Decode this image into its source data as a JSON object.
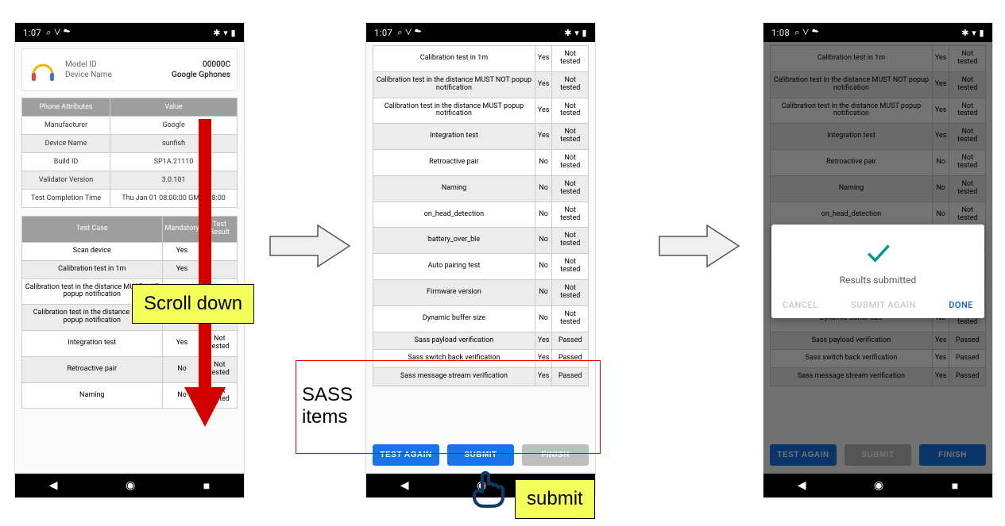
{
  "status": {
    "time1": "1:07",
    "time3": "1:08",
    "leftIcons": "⌕ ⋁ ☁",
    "rightIcons": "✱ ▾ ▮"
  },
  "header": {
    "modelIdLabel": "Model ID",
    "modelId": "00000C",
    "deviceNameLabel": "Device Name",
    "deviceName": "Google Gphones"
  },
  "attr": {
    "h1": "Phone Attributes",
    "h2": "Value",
    "rows": [
      {
        "k": "Manufacturer",
        "v": "Google"
      },
      {
        "k": "Device Name",
        "v": "sunfish"
      },
      {
        "k": "Build ID",
        "v": "SP1A.21110"
      },
      {
        "k": "Validator Version",
        "v": "3.0.101"
      },
      {
        "k": "Test Completion Time",
        "v": "Thu Jan 01 08:00:00 GMT+08:00"
      }
    ]
  },
  "cases": {
    "h1": "Test Case",
    "h2": "Mandatory",
    "h3": "Test Result",
    "p1": [
      {
        "n": "Scan device",
        "m": "Yes",
        "r": ""
      },
      {
        "n": "Calibration test in 1m",
        "m": "Yes",
        "r": ""
      },
      {
        "n": "Calibration test in the distance MUST NOT popup notification",
        "m": "Yes",
        "r": "Not tested"
      },
      {
        "n": "Calibration test in the distance MUST popup notification",
        "m": "Yes",
        "r": "Not tested"
      },
      {
        "n": "Integration test",
        "m": "Yes",
        "r": "Not tested"
      },
      {
        "n": "Retroactive pair",
        "m": "No",
        "r": "Not tested"
      },
      {
        "n": "Naming",
        "m": "No",
        "r": "Not tested"
      }
    ],
    "p2": [
      {
        "n": "Calibration test in 1m",
        "m": "Yes",
        "r": "Not tested"
      },
      {
        "n": "Calibration test in the distance MUST NOT popup notification",
        "m": "Yes",
        "r": "Not tested"
      },
      {
        "n": "Calibration test in the distance MUST popup notification",
        "m": "Yes",
        "r": "Not tested"
      },
      {
        "n": "Integration test",
        "m": "Yes",
        "r": "Not tested"
      },
      {
        "n": "Retroactive pair",
        "m": "No",
        "r": "Not tested"
      },
      {
        "n": "Naming",
        "m": "No",
        "r": "Not tested"
      },
      {
        "n": "on_head_detection",
        "m": "No",
        "r": "Not tested"
      },
      {
        "n": "battery_over_ble",
        "m": "No",
        "r": "Not tested"
      },
      {
        "n": "Auto pairing test",
        "m": "No",
        "r": "Not tested"
      },
      {
        "n": "Firmware version",
        "m": "No",
        "r": "Not tested"
      },
      {
        "n": "Dynamic buffer size",
        "m": "No",
        "r": "Not tested"
      },
      {
        "n": "Sass payload verification",
        "m": "Yes",
        "r": "Passed"
      },
      {
        "n": "Sass switch back verification",
        "m": "Yes",
        "r": "Passed"
      },
      {
        "n": "Sass message stream verification",
        "m": "Yes",
        "r": "Passed"
      }
    ]
  },
  "buttons": {
    "testAgain": "TEST AGAIN",
    "submit": "SUBMIT",
    "finish": "FINISH"
  },
  "dialog": {
    "msg": "Results submitted",
    "cancel": "CANCEL",
    "again": "SUBMIT AGAIN",
    "done": "DONE"
  },
  "annot": {
    "scroll": "Scroll down",
    "sass": "SASS items",
    "submit": "submit"
  },
  "nav": {
    "back": "◀",
    "home": "◉",
    "recent": "■"
  }
}
